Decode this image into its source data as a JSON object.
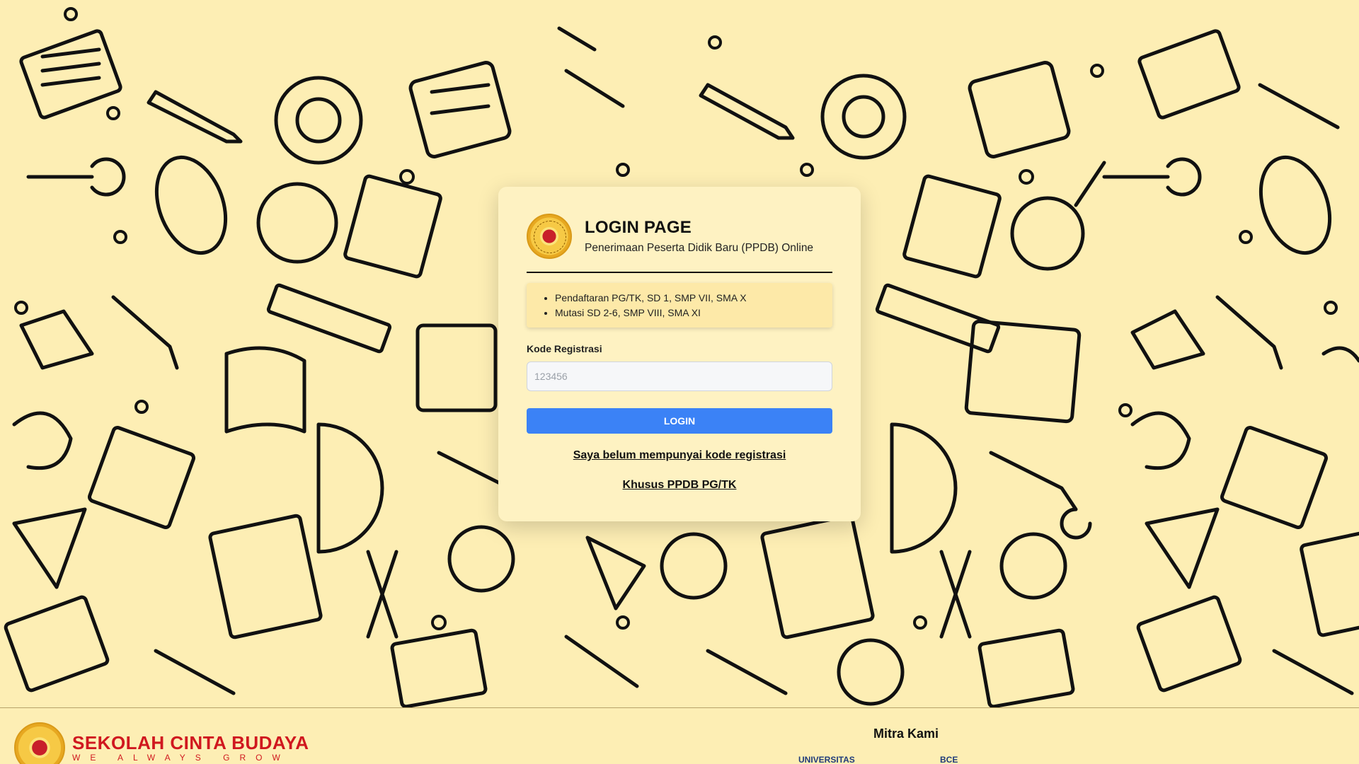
{
  "header": {
    "title": "LOGIN PAGE",
    "subtitle": "Penerimaan Peserta Didik Baru (PPDB) Online"
  },
  "notice": {
    "items": [
      "Pendaftaran PG/TK, SD 1, SMP VII, SMA X",
      "Mutasi SD 2-6, SMP VIII, SMA XI"
    ]
  },
  "form": {
    "label": "Kode Registrasi",
    "placeholder": "123456",
    "login_label": "LOGIN"
  },
  "links": {
    "no_code": "Saya belum mempunyai kode registrasi",
    "pgtk": "Khusus PPDB PG/TK"
  },
  "footer": {
    "brand_name": "SEKOLAH CINTA BUDAYA",
    "brand_tagline": "WE ALWAYS GROW",
    "partners_title": "Mitra Kami",
    "partner_1": "UNIVERSITAS",
    "partner_2": "BCE"
  },
  "colors": {
    "background": "#fdeeb4",
    "primary_button": "#3b82f6",
    "brand_red": "#d0181f"
  }
}
